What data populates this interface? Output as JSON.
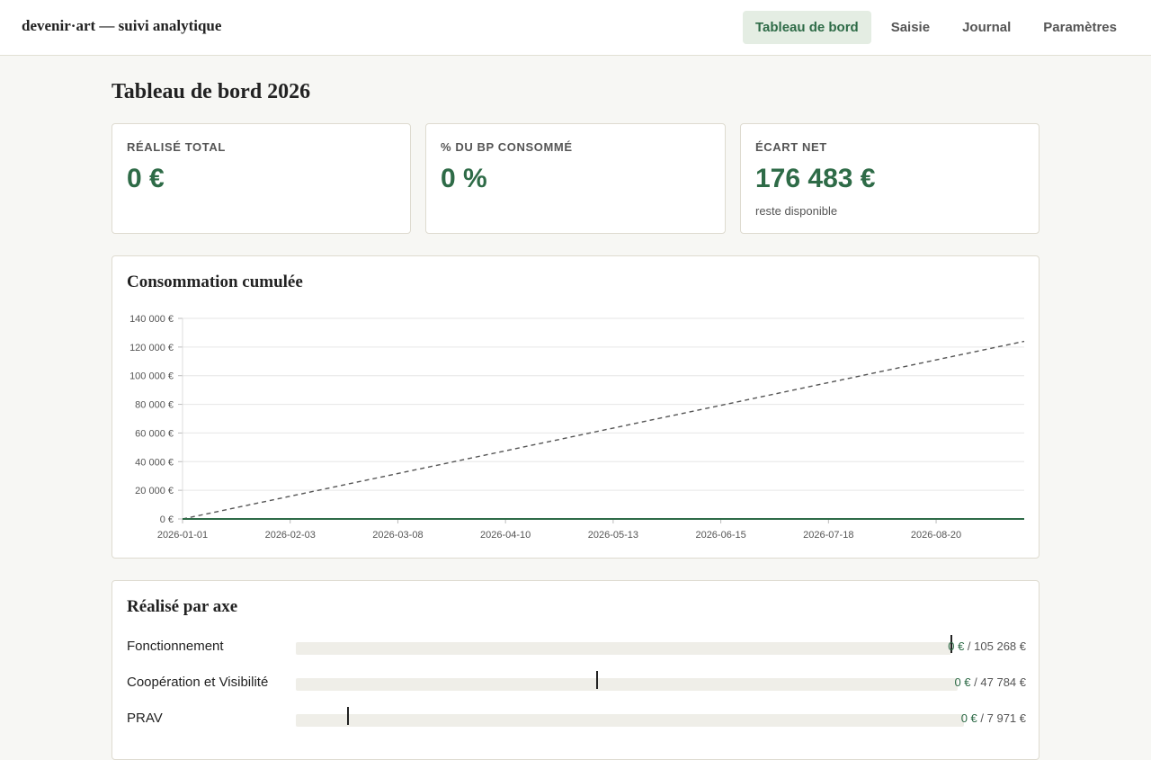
{
  "app": {
    "brand": "devenir·art — suivi analytique"
  },
  "nav": [
    {
      "label": "Tableau de bord",
      "active": true
    },
    {
      "label": "Saisie",
      "active": false
    },
    {
      "label": "Journal",
      "active": false
    },
    {
      "label": "Paramètres",
      "active": false
    }
  ],
  "page": {
    "title": "Tableau de bord 2026"
  },
  "kpis": [
    {
      "label": "RÉALISÉ TOTAL",
      "value": "0 €",
      "note": ""
    },
    {
      "label": "% DU BP CONSOMMÉ",
      "value": "0 %",
      "note": ""
    },
    {
      "label": "ÉCART NET",
      "value": "176 483 €",
      "note": "reste disponible"
    }
  ],
  "chart_section": {
    "title": "Consommation cumulée"
  },
  "chart_data": {
    "type": "line",
    "title": "",
    "xlabel": "",
    "ylabel": "",
    "x_ticks": [
      "2026-01-01",
      "2026-02-03",
      "2026-03-08",
      "2026-04-10",
      "2026-05-13",
      "2026-06-15",
      "2026-07-18",
      "2026-08-20"
    ],
    "y_ticks": [
      "0 €",
      "20 000 €",
      "40 000 €",
      "60 000 €",
      "80 000 €",
      "100 000 €",
      "120 000 €",
      "140 000 €"
    ],
    "ylim": [
      0,
      140000
    ],
    "xlim": [
      "2026-01-01",
      "2026-09-16"
    ],
    "grid": true,
    "series": [
      {
        "style": "dashed",
        "color": "#555555",
        "points": [
          [
            "2026-01-01",
            0
          ],
          [
            "2026-09-16",
            124000
          ]
        ]
      },
      {
        "style": "solid",
        "color": "#2e6b47",
        "points": [
          [
            "2026-01-01",
            0
          ],
          [
            "2026-09-16",
            0
          ]
        ]
      }
    ]
  },
  "axes_section": {
    "title": "Réalisé par axe",
    "rows": [
      {
        "name": "Fonctionnement",
        "realized": "0 €",
        "budget": "105 268 €",
        "expected_fraction": 1.0
      },
      {
        "name": "Coopération et Visibilité",
        "realized": "0 €",
        "budget": "47 784 €",
        "expected_fraction": 0.455
      },
      {
        "name": "PRAV",
        "realized": "0 €",
        "budget": "7 971 €",
        "expected_fraction": 0.078
      }
    ]
  },
  "colors": {
    "accent": "#2e6b47",
    "accent_bg": "#e4ede3",
    "page_bg": "#f7f7f4"
  }
}
